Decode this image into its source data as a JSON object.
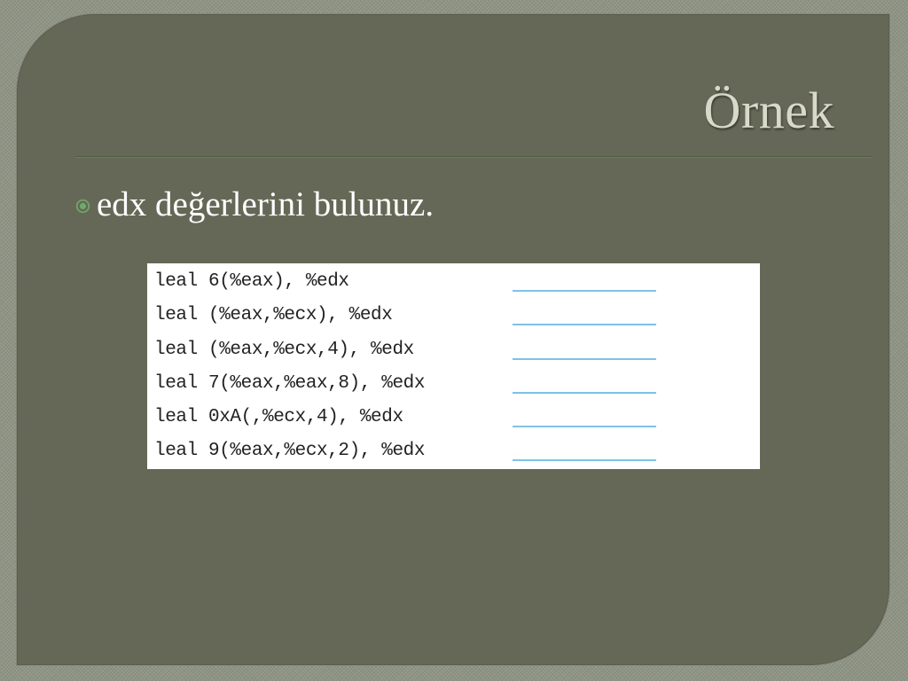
{
  "slide": {
    "title": "Örnek",
    "bullet": "edx değerlerini bulunuz."
  },
  "code_lines": [
    "leal 6(%eax), %edx",
    "leal (%eax,%ecx), %edx",
    "leal (%eax,%ecx,4), %edx",
    "leal 7(%eax,%eax,8), %edx",
    "leal 0xA(,%ecx,4), %edx",
    "leal 9(%eax,%ecx,2), %edx"
  ],
  "icons": {
    "bullet": "circled-dot-bullet-icon"
  },
  "colors": {
    "slide_background": "#666857",
    "page_background": "#8f9585",
    "title_text": "#d8d9c9",
    "body_text": "#ffffff",
    "title_rule": "#4b5d41",
    "answer_blank": "#7fc2e6"
  }
}
